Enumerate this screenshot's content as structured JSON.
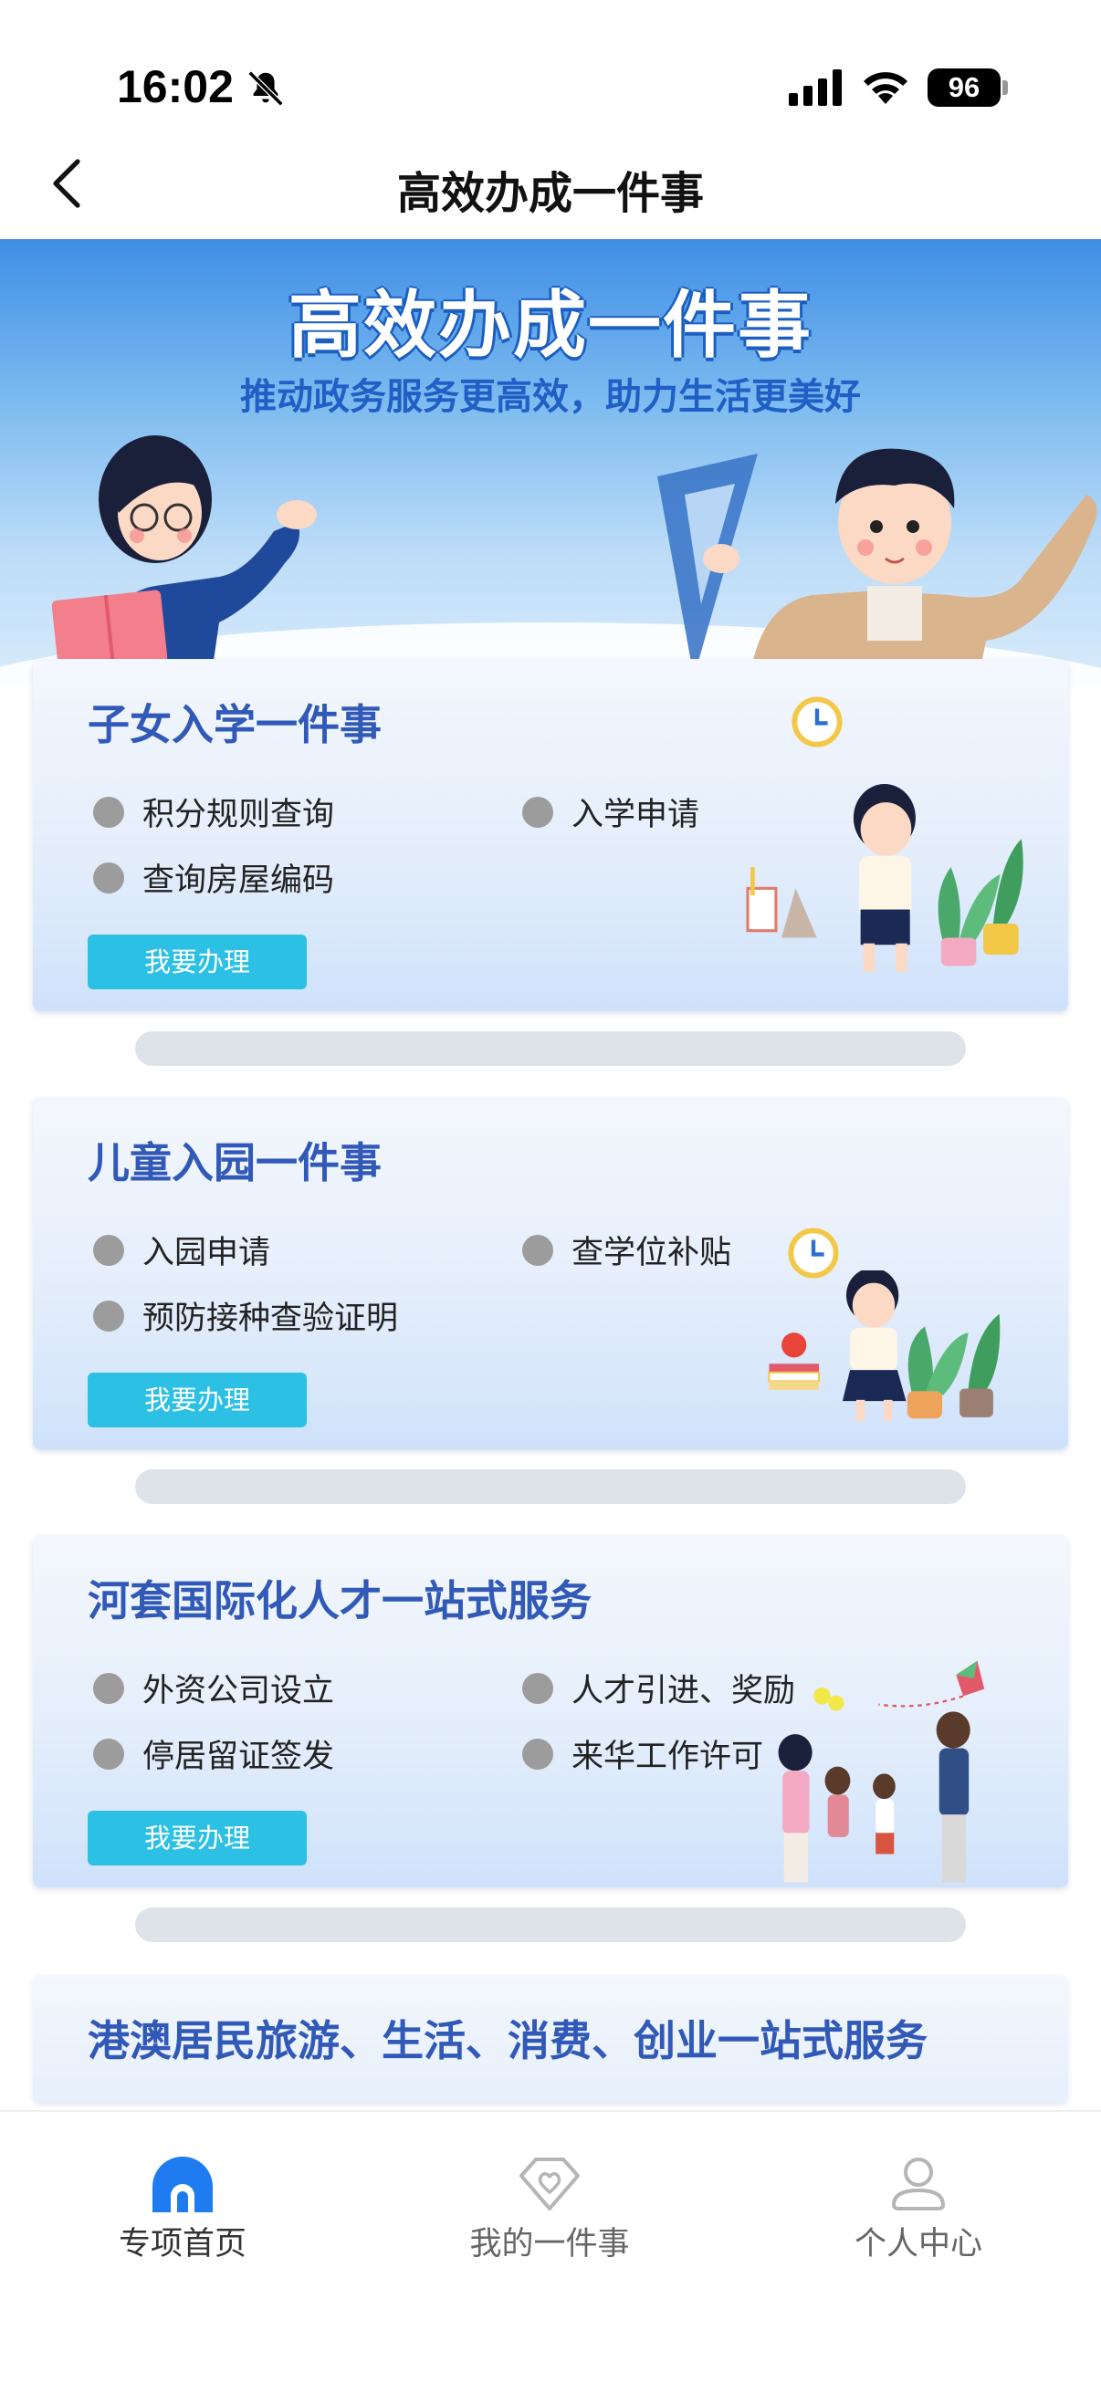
{
  "status_bar": {
    "time": "16:02",
    "battery": "96"
  },
  "nav": {
    "title": "高效办成一件事"
  },
  "banner": {
    "title": "高效办成一件事",
    "subtitle": "推动政务服务更高效，助力生活更美好"
  },
  "cards": [
    {
      "title": "子女入学一件事",
      "items": [
        "积分规则查询",
        "入学申请",
        "查询房屋编码"
      ],
      "button": "我要办理"
    },
    {
      "title": "儿童入园一件事",
      "items": [
        "入园申请",
        "查学位补贴",
        "预防接种查验证明"
      ],
      "button": "我要办理"
    },
    {
      "title": "河套国际化人才一站式服务",
      "items": [
        "外资公司设立",
        "人才引进、奖励",
        "停居留证签发",
        "来华工作许可"
      ],
      "button": "我要办理"
    },
    {
      "title": "港澳居民旅游、生活、消费、创业一站式服务"
    }
  ],
  "tabs": [
    {
      "label": "专项首页",
      "icon": "home-icon",
      "active": true
    },
    {
      "label": "我的一件事",
      "icon": "diamond-heart-icon",
      "active": false
    },
    {
      "label": "个人中心",
      "icon": "user-icon",
      "active": false
    }
  ],
  "colors": {
    "accent_title": "#3159b8",
    "button": "#2bc0e4",
    "tab_active": "#1e7cf0"
  }
}
